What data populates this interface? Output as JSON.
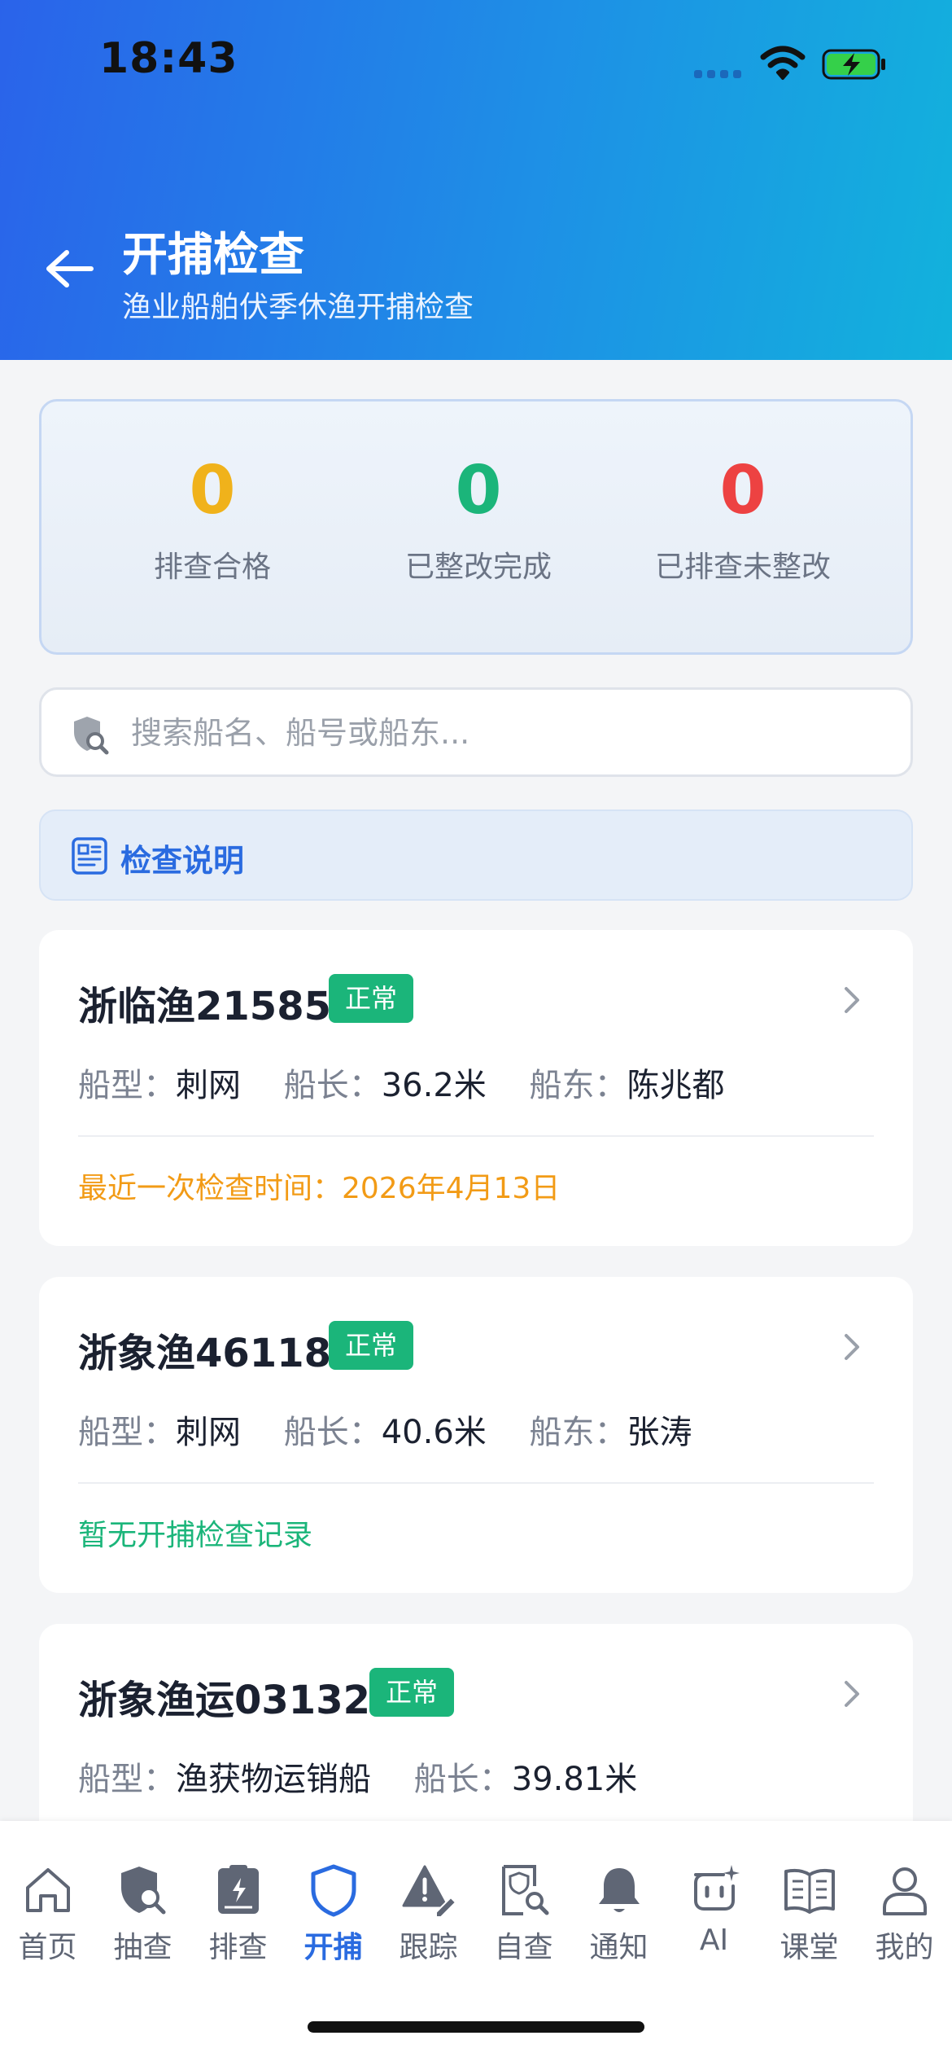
{
  "status_bar": {
    "time": "18:43"
  },
  "header": {
    "title": "开捕检查",
    "subtitle": "渔业船舶伏季休渔开捕检查"
  },
  "stats": [
    {
      "value": "0",
      "label": "排查合格",
      "color": "#f0b21b"
    },
    {
      "value": "0",
      "label": "已整改完成",
      "color": "#1bb57a"
    },
    {
      "value": "0",
      "label": "已排查未整改",
      "color": "#ed4242"
    }
  ],
  "search": {
    "placeholder": "搜索船名、船号或船东..."
  },
  "notice": {
    "label": "检查说明"
  },
  "labels": {
    "type": "船型：",
    "length": "船长：",
    "owner": "船东："
  },
  "vessels": [
    {
      "name": "浙临渔21585",
      "status": "正常",
      "type": "刺网",
      "length": "36.2米",
      "owner": "陈兆都",
      "footer": "最近一次检查时间：2026年4月13日",
      "footer_color": "#f29b16"
    },
    {
      "name": "浙象渔46118",
      "status": "正常",
      "type": "刺网",
      "length": "40.6米",
      "owner": "张涛",
      "footer": "暂无开捕检查记录",
      "footer_color": "#1bb57a"
    },
    {
      "name": "浙象渔运03132",
      "status": "正常",
      "type": "渔获物运销船",
      "length": "39.81米"
    }
  ],
  "tabs": [
    {
      "label": "首页",
      "icon": "home-icon"
    },
    {
      "label": "抽查",
      "icon": "shield-search-icon"
    },
    {
      "label": "排查",
      "icon": "clipboard-lightning-icon"
    },
    {
      "label": "开捕",
      "icon": "shield-icon",
      "active": true
    },
    {
      "label": "跟踪",
      "icon": "warning-edit-icon"
    },
    {
      "label": "自查",
      "icon": "document-search-icon"
    },
    {
      "label": "通知",
      "icon": "bell-icon"
    },
    {
      "label": "AI",
      "icon": "ai-chat-icon"
    },
    {
      "label": "课堂",
      "icon": "book-icon"
    },
    {
      "label": "我的",
      "icon": "user-icon"
    }
  ],
  "colors": {
    "accent": "#2a6be0",
    "success": "#1bb57a",
    "warning": "#f0b21b",
    "danger": "#ed4242"
  }
}
